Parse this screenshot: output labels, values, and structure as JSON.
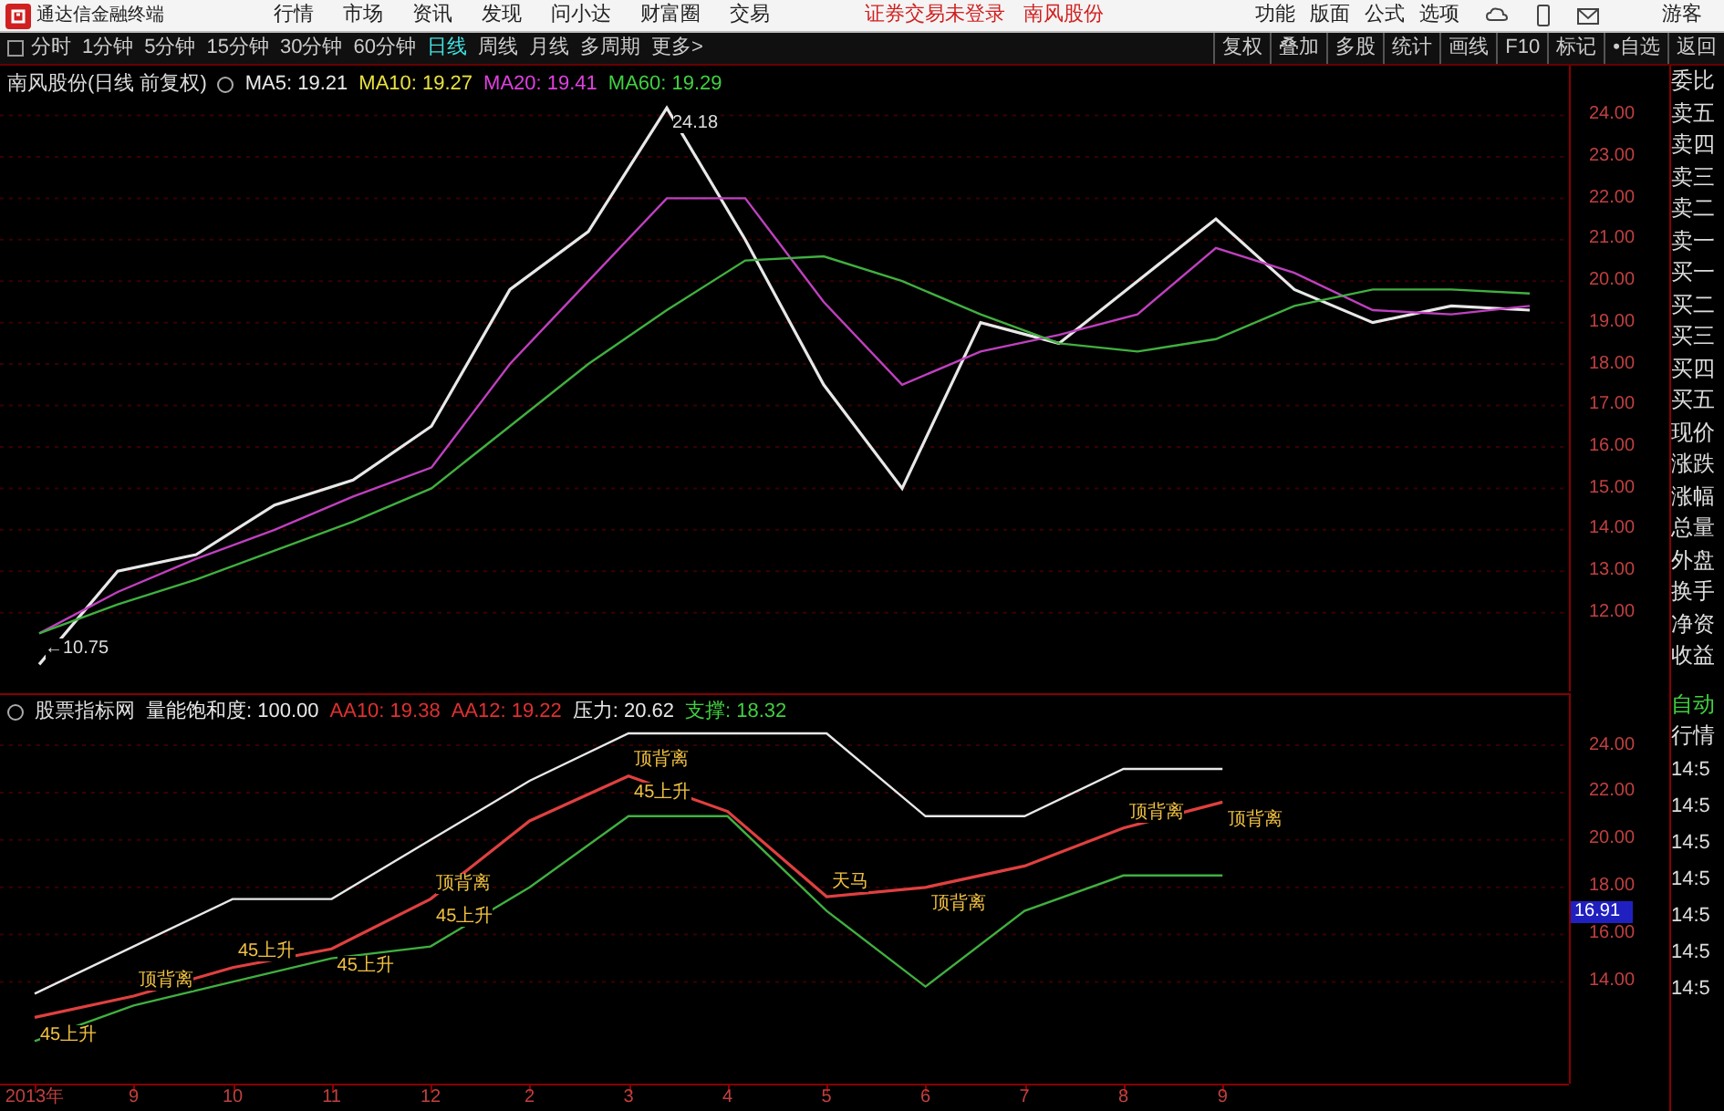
{
  "app": {
    "title": "通达信金融终端"
  },
  "menu": [
    {
      "label": "行情"
    },
    {
      "label": "市场"
    },
    {
      "label": "资讯"
    },
    {
      "label": "发现"
    },
    {
      "label": "问小达"
    },
    {
      "label": "财富圈"
    },
    {
      "label": "交易"
    }
  ],
  "notices": [
    {
      "label": "证券交易未登录"
    },
    {
      "label": "南风股份"
    }
  ],
  "right_menu": [
    {
      "label": "功能"
    },
    {
      "label": "版面"
    },
    {
      "label": "公式"
    },
    {
      "label": "选项"
    }
  ],
  "user": {
    "label": "游客"
  },
  "periods": [
    {
      "label": "分时",
      "selected": false
    },
    {
      "label": "1分钟",
      "selected": false
    },
    {
      "label": "5分钟",
      "selected": false
    },
    {
      "label": "15分钟",
      "selected": false
    },
    {
      "label": "30分钟",
      "selected": false
    },
    {
      "label": "60分钟",
      "selected": false
    },
    {
      "label": "日线",
      "selected": true
    },
    {
      "label": "周线",
      "selected": false
    },
    {
      "label": "月线",
      "selected": false
    },
    {
      "label": "多周期",
      "selected": false
    },
    {
      "label": "更多>",
      "selected": false
    }
  ],
  "tools": [
    {
      "label": "复权"
    },
    {
      "label": "叠加"
    },
    {
      "label": "多股"
    },
    {
      "label": "统计"
    },
    {
      "label": "画线"
    },
    {
      "label": "F10"
    },
    {
      "label": "标记"
    },
    {
      "label": "•自选"
    },
    {
      "label": "返回"
    }
  ],
  "main_panel": {
    "title": "南风股份(日线 前复权)",
    "indicators": [
      {
        "label": "MA5: 19.21",
        "color": "#e8e8e8"
      },
      {
        "label": "MA10: 19.27",
        "color": "#e8e040"
      },
      {
        "label": "MA20: 19.41",
        "color": "#e040e0"
      },
      {
        "label": "MA60: 19.29",
        "color": "#40d040"
      }
    ],
    "chart_data": {
      "type": "line",
      "grid": true,
      "ylim": [
        10.1,
        25.2
      ],
      "yticks": [
        {
          "value": 12,
          "label": "12.00"
        },
        {
          "value": 13,
          "label": "13.00"
        },
        {
          "value": 14,
          "label": "14.00"
        },
        {
          "value": 15,
          "label": "15.00"
        },
        {
          "value": 16,
          "label": "16.00"
        },
        {
          "value": 17,
          "label": "17.00"
        },
        {
          "value": 18,
          "label": "18.00"
        },
        {
          "value": 19,
          "label": "19.00"
        },
        {
          "value": 20,
          "label": "20.00"
        },
        {
          "value": 21,
          "label": "21.00"
        },
        {
          "value": 22,
          "label": "22.00"
        },
        {
          "value": 23,
          "label": "23.00"
        },
        {
          "value": 24,
          "label": "24.00"
        }
      ],
      "series": [
        {
          "color": "#e8e8e8",
          "values": [
            10.75,
            13.0,
            13.4,
            14.6,
            15.2,
            16.5,
            19.8,
            21.2,
            24.18,
            21.0,
            17.5,
            15.0,
            19.0,
            18.5,
            20.0,
            21.5,
            19.8,
            19.0,
            19.4,
            19.3
          ]
        },
        {
          "color": "#c040c0",
          "values": [
            11.5,
            12.5,
            13.3,
            14.0,
            14.8,
            15.5,
            18.0,
            20.0,
            22.0,
            22.0,
            19.5,
            17.5,
            18.3,
            18.7,
            19.2,
            20.8,
            20.2,
            19.3,
            19.2,
            19.4
          ]
        },
        {
          "color": "#40b040",
          "values": [
            11.5,
            12.2,
            12.8,
            13.5,
            14.2,
            15.0,
            16.5,
            18.0,
            19.3,
            20.5,
            20.6,
            20.0,
            19.2,
            18.5,
            18.3,
            18.6,
            19.4,
            19.8,
            19.8,
            19.7
          ]
        }
      ],
      "annotations": [
        "24.18",
        "←10.75"
      ]
    }
  },
  "sub_panel": {
    "title": "股票指标网",
    "indicators": [
      {
        "label": "量能饱和度: 100.00",
        "color": "#e8e8e8"
      },
      {
        "label": "AA10: 19.38",
        "color": "#e03030"
      },
      {
        "label": "AA12: 19.22",
        "color": "#e03030"
      },
      {
        "label": "压力: 20.62",
        "color": "#e8e8e8"
      },
      {
        "label": "支撑: 18.32",
        "color": "#40d040"
      }
    ],
    "price_tag": "16.91",
    "chart_data": {
      "type": "line",
      "grid": true,
      "ylim": [
        9.7,
        26.2
      ],
      "categories": [
        "2013年",
        "9",
        "10",
        "11",
        "12",
        "2",
        "3",
        "4",
        "5",
        "6",
        "7",
        "8",
        "9"
      ],
      "yticks": [
        {
          "value": 14,
          "label": "14.00"
        },
        {
          "value": 16,
          "label": "16.00"
        },
        {
          "value": 18,
          "label": "18.00"
        },
        {
          "value": 20,
          "label": "20.00"
        },
        {
          "value": 22,
          "label": "22.00"
        },
        {
          "value": 24,
          "label": "24.00"
        }
      ],
      "series": [
        {
          "color": "#e04040",
          "values": [
            12.5,
            13.4,
            14.6,
            15.4,
            17.5,
            20.8,
            22.7,
            21.2,
            17.6,
            18.0,
            18.9,
            20.5,
            21.6
          ]
        },
        {
          "color": "#e8e8e8",
          "values": [
            13.5,
            15.5,
            17.5,
            17.5,
            20.0,
            22.5,
            24.5,
            24.5,
            24.5,
            21.0,
            21.0,
            23.0,
            23.0
          ]
        },
        {
          "color": "#40b040",
          "values": [
            11.5,
            13.0,
            14.0,
            15.0,
            15.5,
            18.0,
            21.0,
            21.0,
            17.0,
            13.8,
            17.0,
            18.5,
            18.5
          ]
        }
      ],
      "annotations": [
        "顶背离",
        "45上升",
        "45上升",
        "45上升",
        "顶背离",
        "45上升",
        "顶背离",
        "45上升",
        "天马",
        "顶背离",
        "顶背离",
        "顶背离"
      ]
    }
  },
  "quote_labels": [
    {
      "label": "委比"
    },
    {
      "label": "卖五"
    },
    {
      "label": "卖四"
    },
    {
      "label": "卖三"
    },
    {
      "label": "卖二"
    },
    {
      "label": "卖一"
    },
    {
      "label": "买一"
    },
    {
      "label": "买二"
    },
    {
      "label": "买三"
    },
    {
      "label": "买四"
    },
    {
      "label": "买五"
    },
    {
      "label": "现价"
    },
    {
      "label": "涨跌"
    },
    {
      "label": "涨幅"
    },
    {
      "label": "总量"
    },
    {
      "label": "外盘"
    },
    {
      "label": "换手"
    },
    {
      "label": "净资"
    },
    {
      "label": "收益"
    }
  ],
  "tick_panel": {
    "title": "自动",
    "subtitle": "行情",
    "times": [
      "14:5",
      "14:5",
      "14:5",
      "14:5",
      "14:5",
      "14:5",
      "14:5"
    ]
  }
}
